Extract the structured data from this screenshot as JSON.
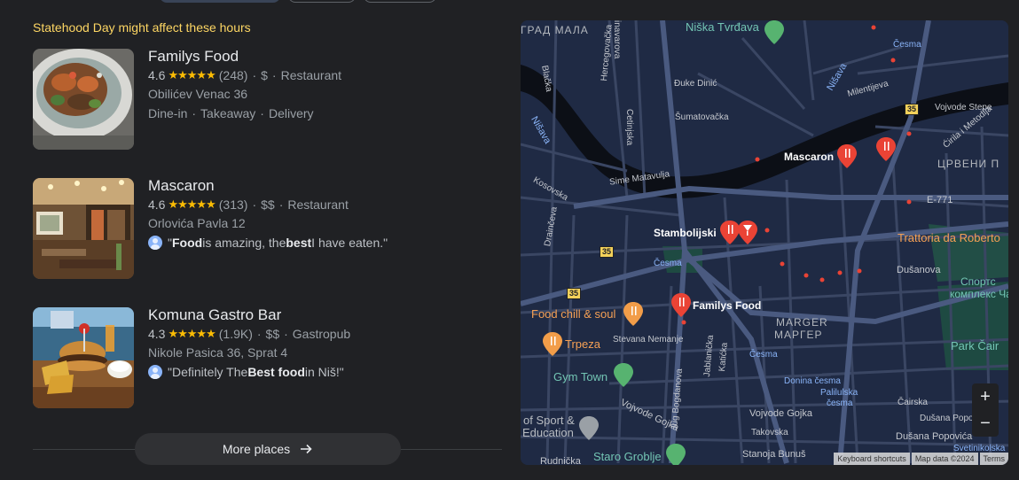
{
  "notice": "Statehood Day might affect these hours",
  "places": [
    {
      "name": "Familys Food",
      "rating": "4.6",
      "stars": "★★★★★",
      "reviews": "(248)",
      "price": "$",
      "category": "Restaurant",
      "address": "Obilićev Venac 36",
      "services": [
        "Dine-in",
        "Takeaway",
        "Delivery"
      ]
    },
    {
      "name": "Mascaron",
      "rating": "4.6",
      "stars": "★★★★★",
      "reviews": "(313)",
      "price": "$$",
      "category": "Restaurant",
      "address": "Orlovića Pavla 12",
      "review_parts": [
        "\"",
        "Food",
        " is amazing, the ",
        "best",
        " I have eaten.\""
      ]
    },
    {
      "name": "Komuna Gastro Bar",
      "rating": "4.3",
      "stars": "★★★★★",
      "reviews": "(1.9K)",
      "price": "$$",
      "category": "Gastropub",
      "address": "Nikole Pasica 36, Sprat 4",
      "review_parts": [
        "\"Definitely The ",
        "Best food",
        " in Niš!\""
      ]
    }
  ],
  "more_places_label": "More places",
  "map": {
    "labels": {
      "grad_mala": "ГРАД МАЛА",
      "niska_tvrdava": "Niška Tvrđava",
      "cesma1": "Česma",
      "inavarova": "inavarova",
      "blacka": "Blačka",
      "hercegovacka": "Hercegovačka",
      "duke_dinic": "Đuke Dinić",
      "milentijeva": "Milentijeva",
      "nisava_river1": "Nišava",
      "vojvode_stepe": "Vojvode Stepe",
      "cetinjska": "Cetinjska",
      "sumatovacka": "Šumatovačka",
      "cirila": "Ćirila i Metodija",
      "nisava_river2": "Nišava",
      "mascaron": "Mascaron",
      "crveni_p": "ЦРВЕНИ П",
      "sime_matavulja": "Sime Matavulja",
      "kosovska": "Kosovska",
      "e771": "E-771",
      "stambolijski": "Stambolijski",
      "trattoria": "Trattoria da Roberto",
      "drainceva": "Drainčeva",
      "cesma2": "Česma",
      "dusanova": "Dušanova",
      "sportski": "Спортс",
      "kompleks": "комплекс Ча",
      "familys_food": "Familys Food",
      "food_chill": "Food chill & soul",
      "marger": "MARGER",
      "marger_cyr": "МАРГЕР",
      "trpeza": "Trpeza",
      "stevana_nemanje": "Stevana Nemanje",
      "jug_bogdanova": "Jug Bogdanova",
      "jablanicka": "Jablanička",
      "katicka": "Katićka",
      "cesma3": "Česma",
      "park_cair": "Park Čair",
      "gym_town": "Gym Town",
      "donina_cesma": "Donina česma",
      "palilulska": "Palilulska",
      "cesma4": "česma",
      "cairska": "Čairska",
      "vojvode_gojka1": "Vojvode Gojka",
      "vojvode_gojka2": "Vojvode Gojka",
      "of_sport": "of Sport &",
      "education": "Education",
      "takovska": "Takovska",
      "dusana_popovic": "Dušana Popović",
      "dusana_popovica": "Dušana Popovića",
      "svetinikolska": "Svetinikolska",
      "staro_groblje": "Staro Groblje",
      "stanoja_bunus": "Stanoja Bunuš",
      "rudnicka": "Rudnička"
    },
    "shields": {
      "s35a": "35",
      "s35b": "35",
      "s35c": "35"
    },
    "zoom_in": "+",
    "zoom_out": "−",
    "attribution": {
      "shortcuts": "Keyboard shortcuts",
      "map_data": "Map data ©2024",
      "terms": "Terms"
    }
  }
}
